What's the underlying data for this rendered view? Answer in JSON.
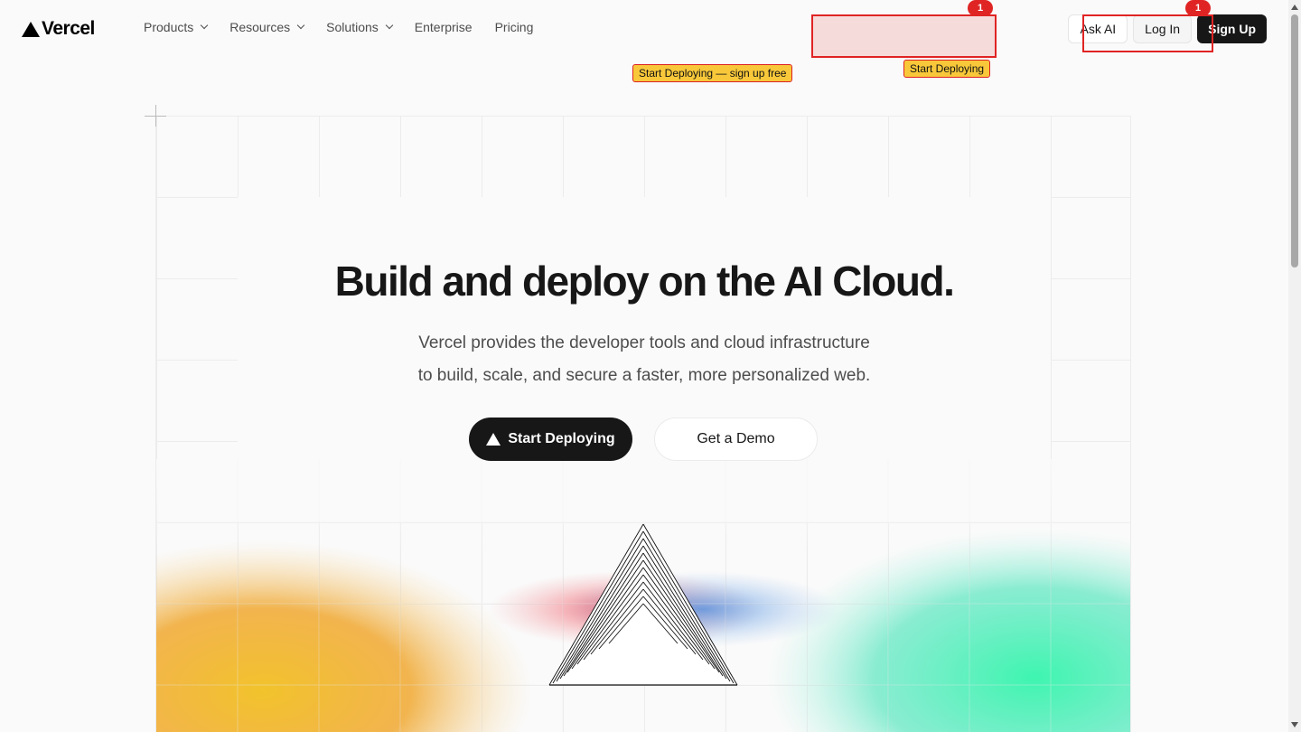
{
  "nav": {
    "logo_text": "Vercel",
    "links": [
      {
        "label": "Products",
        "has_menu": true
      },
      {
        "label": "Resources",
        "has_menu": true
      },
      {
        "label": "Solutions",
        "has_menu": true
      },
      {
        "label": "Enterprise",
        "has_menu": false
      },
      {
        "label": "Pricing",
        "has_menu": false
      }
    ],
    "ask_ai": "Ask AI",
    "log_in": "Log In",
    "sign_up": "Sign Up"
  },
  "annotations": {
    "badge_1": "1",
    "badge_2": "1",
    "tag_1": "Start Deploying — sign up free",
    "tag_2": "Start Deploying"
  },
  "hero": {
    "headline": "Build and deploy on the AI Cloud.",
    "sub_line_1": "Vercel provides the developer tools and cloud infrastructure",
    "sub_line_2": "to build, scale, and secure a faster, more personalized web.",
    "primary_cta": "Start Deploying",
    "secondary_cta": "Get a Demo"
  },
  "colors": {
    "accent_dark": "#171717",
    "annotation_red": "#e02424",
    "annotation_tag": "#f8c83a"
  }
}
